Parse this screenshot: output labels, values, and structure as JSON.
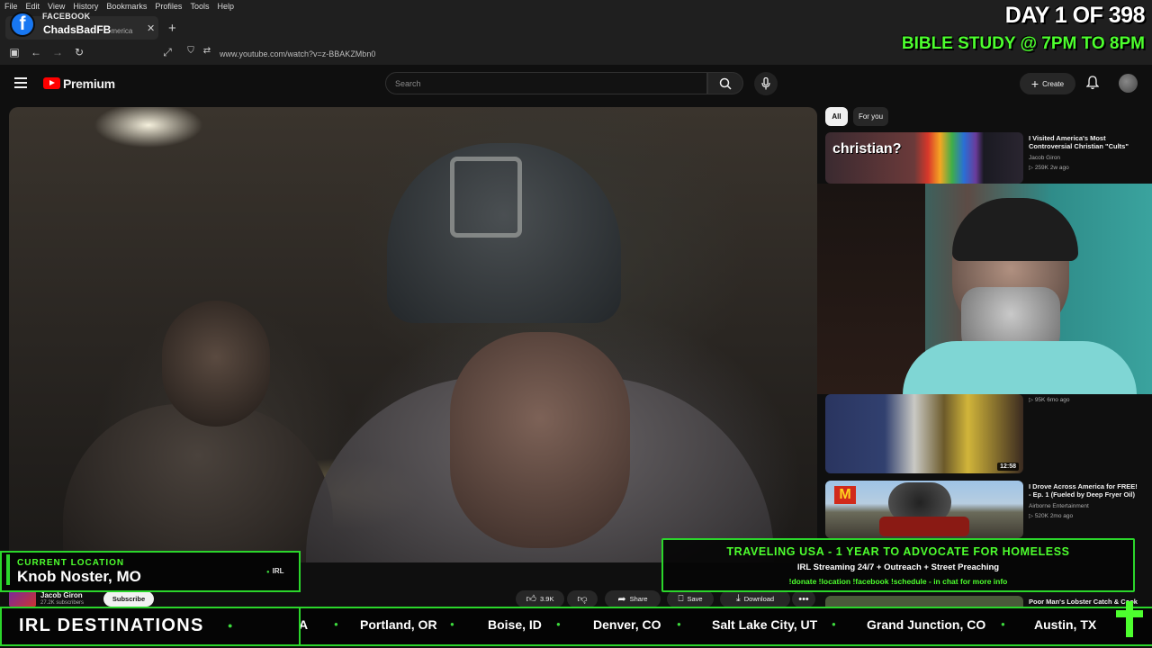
{
  "browser": {
    "menu": [
      "File",
      "Edit",
      "View",
      "History",
      "Bookmarks",
      "Profiles",
      "Tools",
      "Help"
    ],
    "tab_title": "ChadsBadFB",
    "tab_title_trailing": "merica",
    "url": "www.youtube.com/watch?v=z-BBAKZMbn0"
  },
  "facebook_badge": {
    "letter": "f",
    "label": "FACEBOOK"
  },
  "youtube": {
    "brand": "Premium",
    "search_placeholder": "Search",
    "create_label": "Create"
  },
  "sidebar": {
    "chips": [
      "All",
      "For you"
    ],
    "recs": [
      {
        "thumb_text": "christian?",
        "title": "I Visited America's Most Controversial Christian \"Cults\"",
        "channel": "Jacob Giron",
        "stats": "259K",
        "age": "2w ago"
      },
      {
        "stats": "95K",
        "age": "6mo ago",
        "duration": "12:58"
      },
      {
        "title": "I Drove Across America for FREE! - Ep. 1 (Fueled by Deep Fryer Oil)",
        "channel": "Airborne Entertainment",
        "stats": "520K",
        "age": "2mo ago"
      },
      {
        "title": "Poor Man's Lobster Catch & Cook"
      }
    ]
  },
  "video_meta": {
    "channel": "Jacob Giron",
    "subscribers": "27.2K subscribers",
    "subscribe_label": "Subscribe",
    "likes": "3.9K",
    "share": "Share",
    "save": "Save",
    "download": "Download"
  },
  "overlay": {
    "day_counter": "DAY 1 OF 398",
    "bible_study": "BIBLE STUDY @  7PM TO 8PM",
    "location_label": "CURRENT LOCATION",
    "location_value": "Knob Noster, MO",
    "irl_tag": "IRL",
    "banner_title": "TRAVELING USA - 1 YEAR TO ADVOCATE FOR HOMELESS",
    "banner_sub": "IRL Streaming 24/7 + Outreach + Street Preaching",
    "banner_commands": "!donate !location !facebook !schedule - in chat for more info",
    "ticker_title": "IRL DESTINATIONS",
    "ticker_fragment": "A",
    "cities": [
      "Portland, OR",
      "Boise, ID",
      "Denver, CO",
      "Salt Lake City, UT",
      "Grand Junction, CO",
      "Austin, TX"
    ]
  },
  "colors": {
    "accent_green": "#4dff2e",
    "youtube_red": "#ff0000",
    "facebook_blue": "#1877f2"
  }
}
